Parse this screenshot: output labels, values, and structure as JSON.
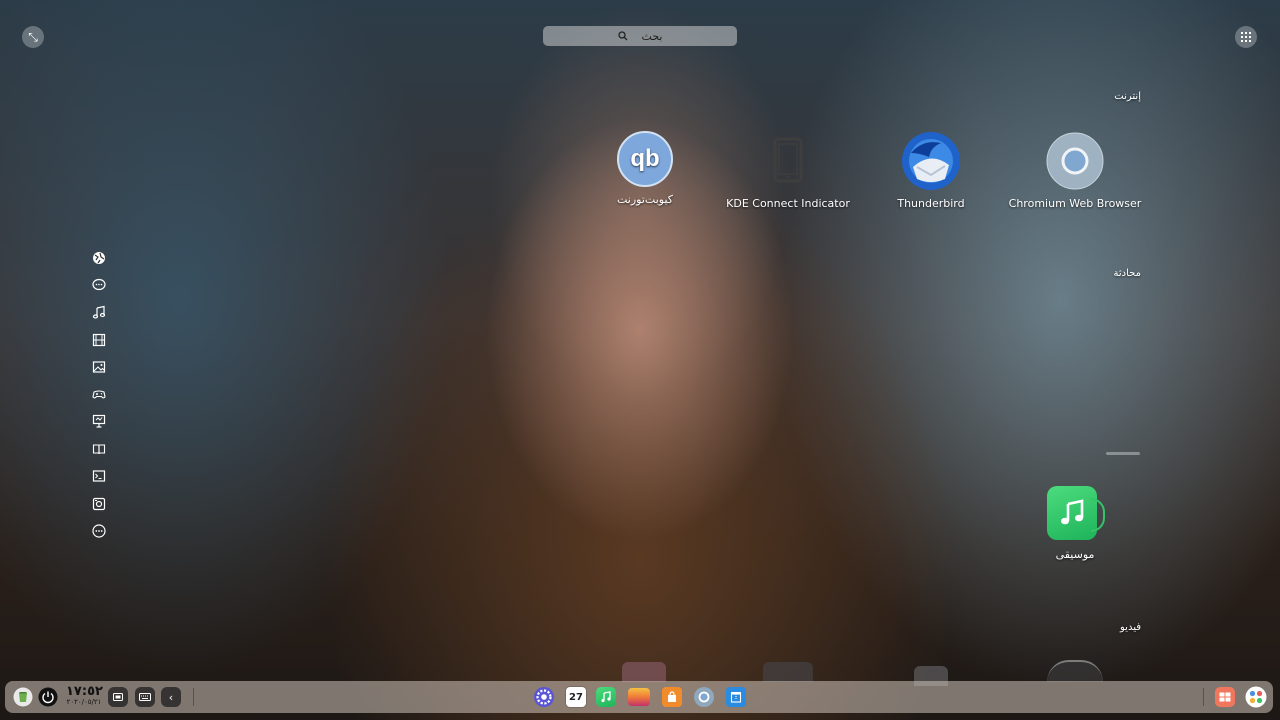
{
  "search": {
    "placeholder": "بحث"
  },
  "categories": [
    {
      "label": "إنترنت"
    },
    {
      "label": "محادثة"
    },
    {
      "label": "فيديو"
    }
  ],
  "apps": {
    "chromium": {
      "label": "Chromium Web Browser"
    },
    "thunderbird": {
      "label": "Thunderbird"
    },
    "kdeconnect": {
      "label": "KDE Connect Indicator"
    },
    "qbittorrent": {
      "label": "كيوبت‌تورنت",
      "glyph": "qb"
    },
    "music": {
      "label": "موسيقى"
    }
  },
  "sidebar": {
    "items": [
      {
        "icon": "internet-icon"
      },
      {
        "icon": "chat-icon"
      },
      {
        "icon": "music-icon"
      },
      {
        "icon": "video-icon"
      },
      {
        "icon": "image-icon"
      },
      {
        "icon": "game-icon"
      },
      {
        "icon": "office-icon"
      },
      {
        "icon": "reading-icon"
      },
      {
        "icon": "terminal-icon"
      },
      {
        "icon": "system-icon"
      },
      {
        "icon": "more-icon"
      }
    ]
  },
  "taskbar": {
    "time": "١٧:٥٢",
    "date": "٢٠٢٠/٠٥/٢١",
    "calendar_day": "27"
  },
  "colors": {
    "accent_blue": "#4a90e2",
    "music_green": "#2ecc71"
  }
}
